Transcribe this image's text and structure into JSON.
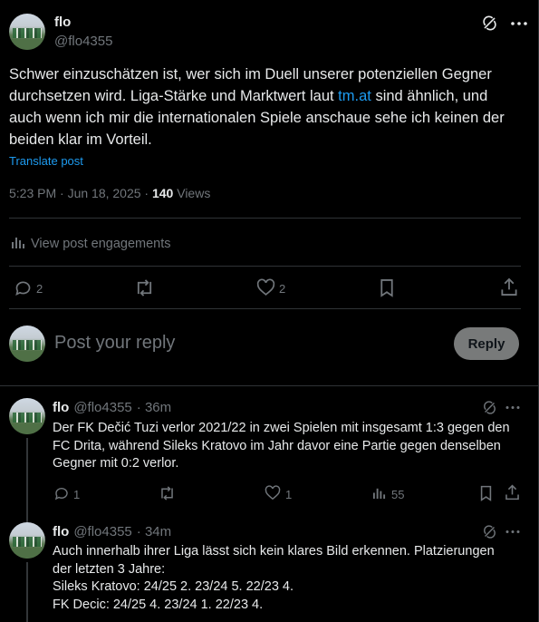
{
  "main_post": {
    "author_name": "flo",
    "author_handle": "@flo4355",
    "text_before_link": "Schwer einzuschätzen ist, wer sich im Duell unserer potenziellen Gegner durchsetzen wird. Liga-Stärke und Marktwert laut ",
    "link_text": "tm.at",
    "text_after_link": " sind ähnlich, und auch wenn ich mir die internationalen Spiele anschaue sehe ich keinen der beiden klar im Vorteil.",
    "translate_label": "Translate post",
    "timestamp": "5:23 PM · Jun 18, 2025 · ",
    "views_count": "140",
    "views_label": " Views",
    "engagements_label": "View post engagements",
    "replies_count": "2",
    "likes_count": "2"
  },
  "composer": {
    "placeholder": "Post your reply",
    "reply_button": "Reply"
  },
  "replies": [
    {
      "author_name": "flo",
      "author_handle": "@flo4355",
      "time": "· 36m",
      "text_lines": [
        "Der FK Dečić Tuzi verlor 2021/22 in zwei Spielen mit insgesamt 1:3 gegen den",
        "FC Drita, während Sileks Kratovo im Jahr davor eine Partie gegen denselben",
        "Gegner mit 0:2 verlor."
      ],
      "replies_count": "1",
      "likes_count": "1",
      "views_count": "55"
    },
    {
      "author_name": "flo",
      "author_handle": "@flo4355",
      "time": "· 34m",
      "text_lines": [
        "Auch innerhalb ihrer Liga lässt sich kein klares Bild erkennen. Platzierungen",
        "der letzten 3 Jahre:",
        "Sileks Kratovo: 24/25 2. 23/24 5. 22/23 4.",
        "FK Decic: 24/25 4. 23/24 1. 22/23 4."
      ]
    }
  ],
  "icons": {
    "more": "more-icon",
    "grok": "grok-icon",
    "reply": "reply-icon",
    "repost": "repost-icon",
    "like": "like-icon",
    "bookmark": "bookmark-icon",
    "share": "share-icon",
    "analytics": "analytics-icon"
  },
  "colors": {
    "background": "#000000",
    "text": "#e7e9ea",
    "muted": "#71767b",
    "link": "#1d9bf0",
    "divider": "#2f3336",
    "reply_button_bg": "#787a7a"
  }
}
